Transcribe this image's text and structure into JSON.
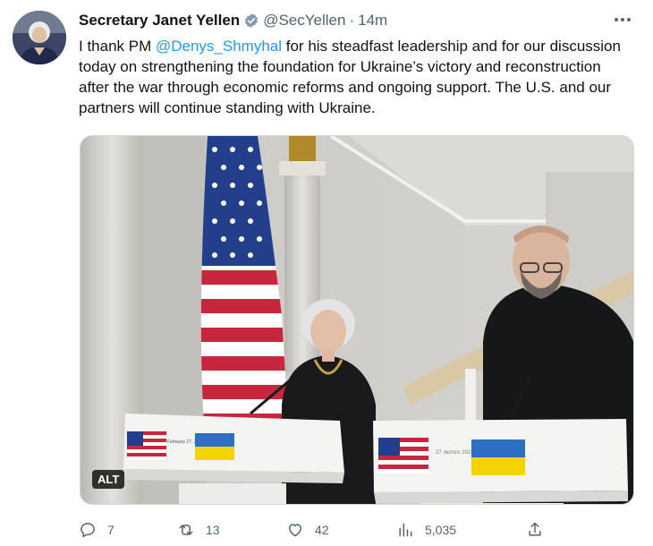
{
  "tweet": {
    "author_name": "Secretary Janet Yellen",
    "handle": "@SecYellen",
    "separator": "·",
    "timestamp": "14m",
    "text_before_mention": "I thank PM ",
    "mention": "@Denys_Shmyhal",
    "text_after_mention": " for his steadfast leadership and for our discussion today on strengthening the foundation for Ukraine’s victory and reconstruction after the war through economic reforms and ongoing support. The U.S. and our partners will continue standing with Ukraine.",
    "alt_label": "ALT",
    "podium_date_left": "February 27, 2023",
    "podium_date_right": "27 лютого 2023"
  },
  "metrics": {
    "replies": "7",
    "retweets": "13",
    "likes": "42",
    "views": "5,035"
  },
  "icons": {
    "verified": "verified-badge-icon",
    "more": "more-dots-icon",
    "reply": "reply-icon",
    "retweet": "retweet-icon",
    "like": "heart-icon",
    "views": "views-bar-chart-icon",
    "share": "share-icon"
  },
  "colors": {
    "link": "#1d9bf0",
    "secondary_text": "#536471",
    "verified_badge": "#829aab"
  }
}
